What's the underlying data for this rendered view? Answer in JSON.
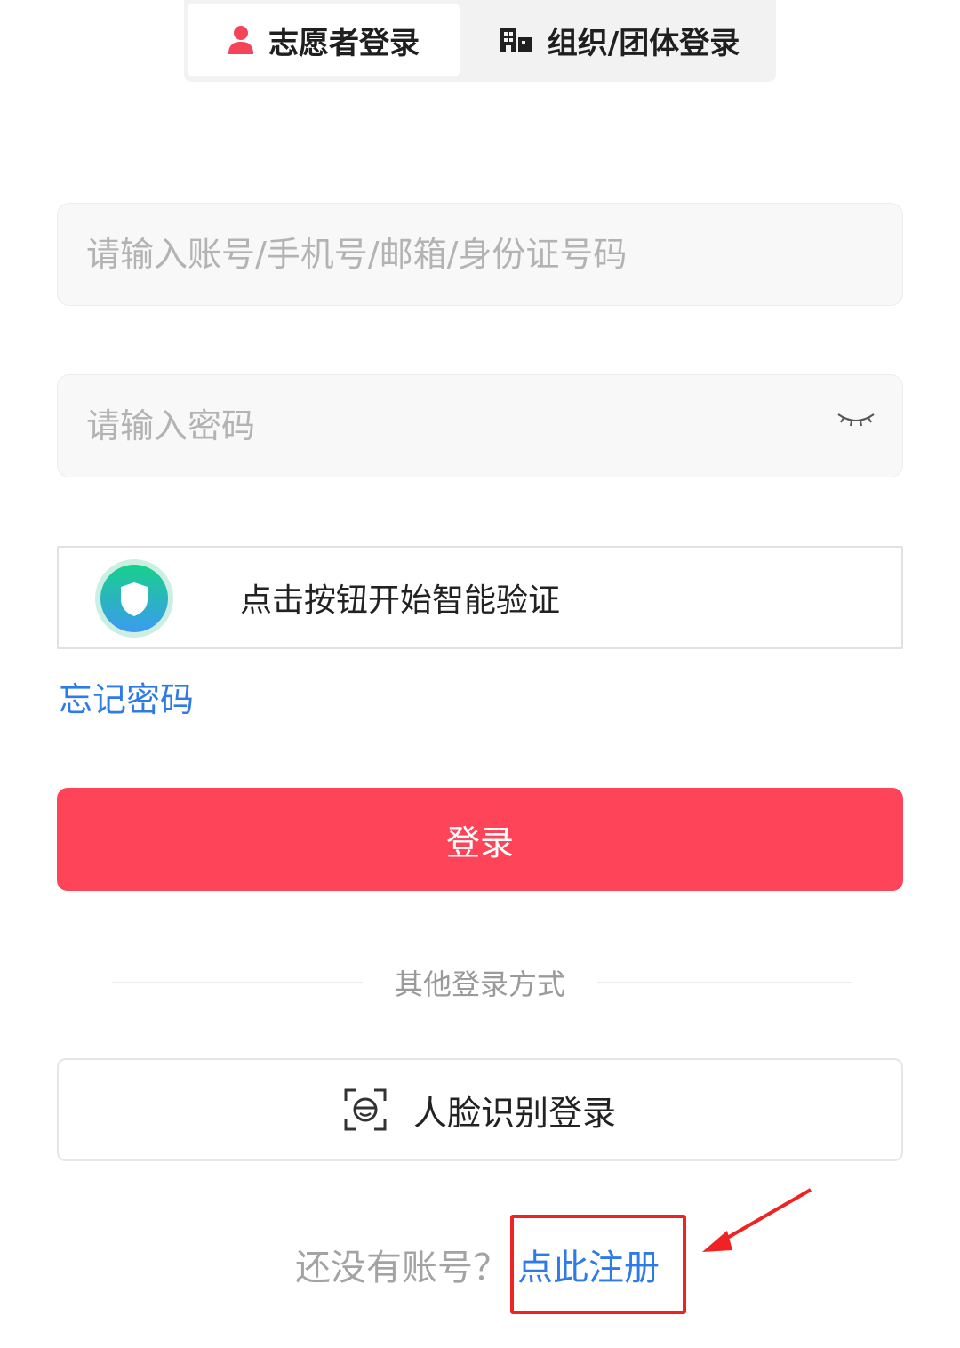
{
  "tabs": [
    {
      "label": "志愿者登录",
      "icon": "person-icon",
      "active": true
    },
    {
      "label": "组织/团体登录",
      "icon": "building-icon",
      "active": false
    }
  ],
  "form": {
    "account_placeholder": "请输入账号/手机号/邮箱/身份证号码",
    "password_placeholder": "请输入密码",
    "captcha_label": "点击按钮开始智能验证",
    "forgot_label": "忘记密码",
    "login_label": "登录"
  },
  "other_login": {
    "title": "其他登录方式",
    "face_label": "人脸识别登录"
  },
  "register": {
    "prompt": "还没有账号？",
    "link": "点此注册"
  },
  "colors": {
    "accent_red": "#fd4458",
    "link_blue": "#2e7be8",
    "annotation_red": "#f02222"
  }
}
